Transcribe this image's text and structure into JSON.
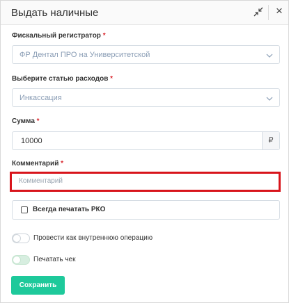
{
  "dialog": {
    "title": "Выдать наличные",
    "close_glyph": "×"
  },
  "fiscal": {
    "label": "Фискальный регистратор",
    "required_mark": "*",
    "value": "ФР Дентал ПРО на Университетской"
  },
  "expense": {
    "label": "Выберите статью расходов",
    "required_mark": "*",
    "value": "Инкассация"
  },
  "amount": {
    "label": "Сумма",
    "required_mark": "*",
    "value": "10000",
    "currency": "₽"
  },
  "comment": {
    "label": "Комментарий",
    "required_mark": "*",
    "placeholder": "Комментарий"
  },
  "print_rko": {
    "label": "Всегда печатать РКО",
    "checked": false
  },
  "internal_op": {
    "label": "Провести как внутреннюю операцию",
    "on": false
  },
  "print_receipt": {
    "label": "Печатать чек",
    "on": true
  },
  "save_button": {
    "label": "Сохранить",
    "color": "#1ec99b"
  },
  "colors": {
    "required": "#d9272e",
    "highlight": "#d8141b",
    "accent": "#1ec99b"
  }
}
